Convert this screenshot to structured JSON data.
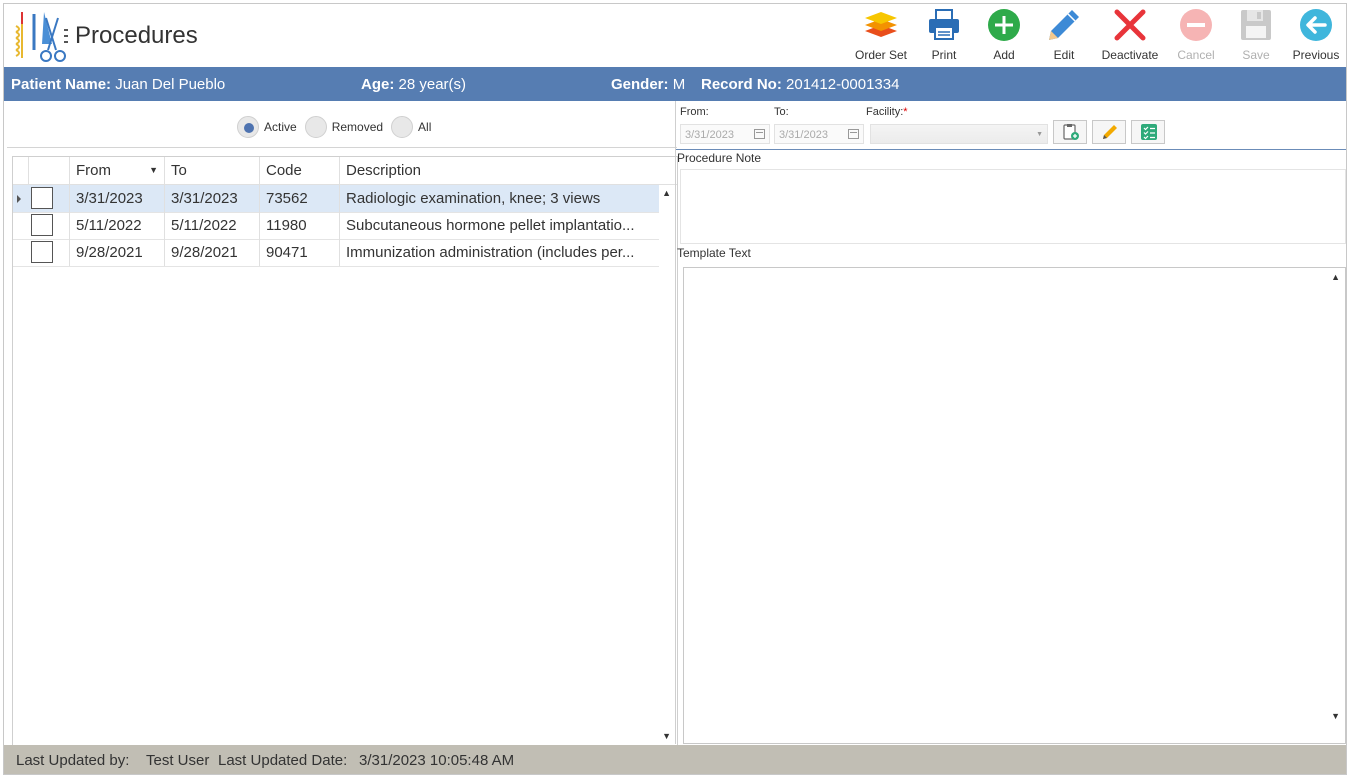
{
  "app": {
    "title": "Procedures"
  },
  "toolbar": [
    {
      "label": "Order Set",
      "icon": "layers-icon",
      "enabled": true
    },
    {
      "label": "Print",
      "icon": "printer-icon",
      "enabled": true
    },
    {
      "label": "Add",
      "icon": "plus-circle-icon",
      "enabled": true
    },
    {
      "label": "Edit",
      "icon": "pencil-icon",
      "enabled": true
    },
    {
      "label": "Deactivate",
      "icon": "x-mark-icon",
      "enabled": true
    },
    {
      "label": "Cancel",
      "icon": "minus-circle-icon",
      "enabled": false
    },
    {
      "label": "Save",
      "icon": "floppy-icon",
      "enabled": false
    },
    {
      "label": "Previous",
      "icon": "arrow-left-circle-icon",
      "enabled": true
    }
  ],
  "patient": {
    "name_label": "Patient Name:",
    "name": "Juan Del Pueblo",
    "age_label": "Age:",
    "age": "28 year(s)",
    "gender_label": "Gender:",
    "gender": "M",
    "record_label": "Record No:",
    "record": "201412-0001334"
  },
  "filter": {
    "options": [
      {
        "label": "Active",
        "selected": true
      },
      {
        "label": "Removed",
        "selected": false
      },
      {
        "label": "All",
        "selected": false
      }
    ]
  },
  "grid": {
    "columns": [
      "From",
      "To",
      "Code",
      "Description"
    ],
    "rows": [
      {
        "from": "3/31/2023",
        "to": "3/31/2023",
        "code": "73562",
        "description": "Radiologic examination, knee; 3 views",
        "checked": false,
        "selected": true
      },
      {
        "from": "5/11/2022",
        "to": "5/11/2022",
        "code": "11980",
        "description": "Subcutaneous hormone pellet implantatio...",
        "checked": false,
        "selected": false
      },
      {
        "from": "9/28/2021",
        "to": "9/28/2021",
        "code": "90471",
        "description": "Immunization administration (includes per...",
        "checked": false,
        "selected": false
      }
    ]
  },
  "detail": {
    "from_label": "From:",
    "from_value": "3/31/2023",
    "to_label": "To:",
    "to_value": "3/31/2023",
    "facility_label": "Facility:",
    "facility_required": "*",
    "procedure_note_label": "Procedure Note",
    "template_text_label": "Template Text"
  },
  "footer": {
    "updated_by_label": "Last Updated by:",
    "updated_by": "Test User",
    "updated_date_label": "Last Updated Date:",
    "updated_date": "3/31/2023 10:05:48 AM"
  },
  "colors": {
    "patient_bar": "#567db2",
    "footer": "#c1beb4",
    "selected_row": "#dce8f6"
  }
}
